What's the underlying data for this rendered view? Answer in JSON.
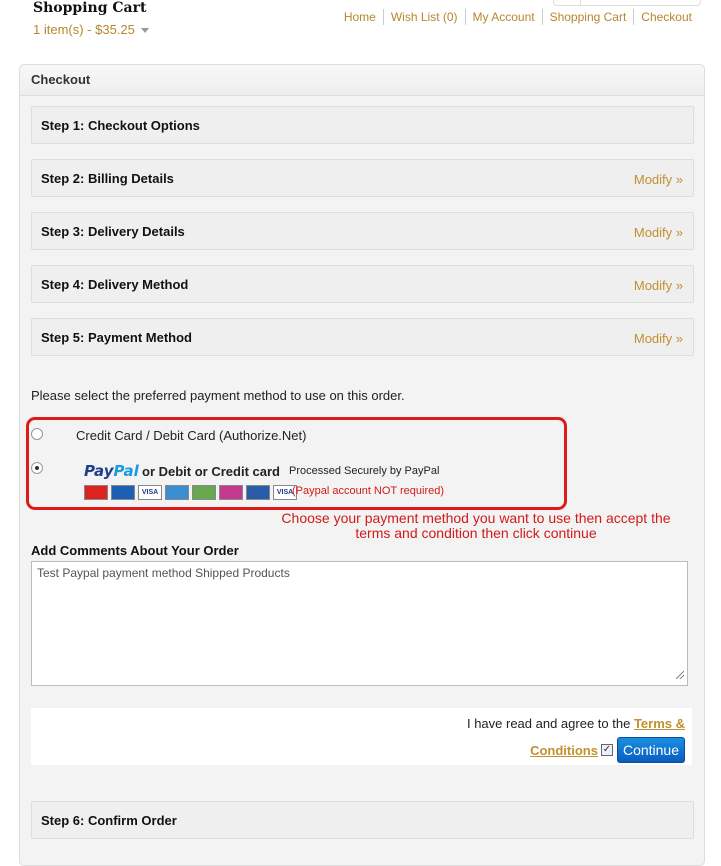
{
  "header": {
    "cart_title": "Shopping Cart",
    "cart_summary": "1 item(s) - $35.25",
    "nav": [
      "Home",
      "Wish List (0)",
      "My Account",
      "Shopping Cart",
      "Checkout"
    ]
  },
  "checkout": {
    "title": "Checkout",
    "steps": [
      {
        "label": "Step 1: Checkout Options",
        "modify": ""
      },
      {
        "label": "Step 2: Billing Details",
        "modify": "Modify »"
      },
      {
        "label": "Step 3: Delivery Details",
        "modify": "Modify »"
      },
      {
        "label": "Step 4: Delivery Method",
        "modify": "Modify »"
      },
      {
        "label": "Step 5: Payment Method",
        "modify": "Modify »"
      },
      {
        "label": "Step 6: Confirm Order",
        "modify": ""
      }
    ],
    "payment": {
      "intro": "Please select the preferred payment method to use on this order.",
      "option_cc": "Credit Card / Debit Card (Authorize.Net)",
      "paypal_pay": "Pay",
      "paypal_pal": "Pal",
      "paypal_or": "or Debit or Credit card",
      "paypal_processed": "Processed Securely by PayPal",
      "paypal_note": "(Paypal account NOT required)",
      "selected": "paypal"
    },
    "instruction": "Choose your payment method you want to use then accept the terms and condition then click continue",
    "comments_label": "Add Comments About Your Order",
    "comments_value": "Test Paypal payment method Shipped Products",
    "agree_text": "I have read and agree to the ",
    "terms_link": "Terms &",
    "conditions_link": "Conditions",
    "continue_label": "Continue"
  }
}
